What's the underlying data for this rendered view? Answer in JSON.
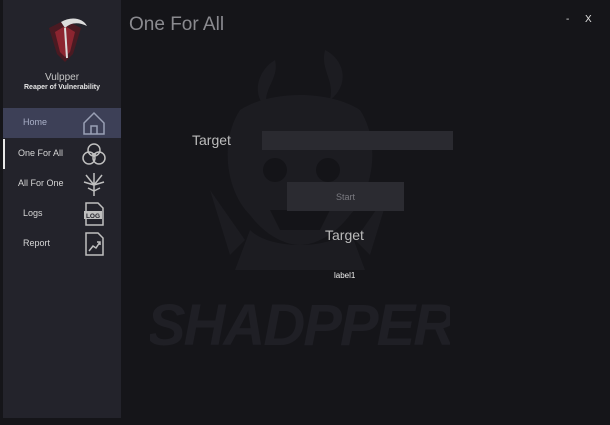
{
  "window": {
    "minimize_label": "-",
    "close_label": "X"
  },
  "sidebar": {
    "app_name": "Vulpper",
    "app_subtitle": "Reaper of Vulnerability",
    "items": [
      {
        "label": "Home",
        "icon": "home-icon",
        "active": true
      },
      {
        "label": "One For All",
        "icon": "biohazard-icon",
        "selected": true
      },
      {
        "label": "All For One",
        "icon": "thistle-icon"
      },
      {
        "label": "Logs",
        "icon": "log-file-icon"
      },
      {
        "label": "Report",
        "icon": "chart-report-icon"
      }
    ]
  },
  "main": {
    "title": "One For All",
    "target_label": "Target",
    "target_input_value": "",
    "start_button": "Start",
    "result_label": "Target",
    "status_label": "label1",
    "watermark_text": "SHADPPER"
  },
  "colors": {
    "background": "#151519",
    "sidebar": "#23232b",
    "active_nav": "#3d4057",
    "input": "#2a2a30"
  }
}
